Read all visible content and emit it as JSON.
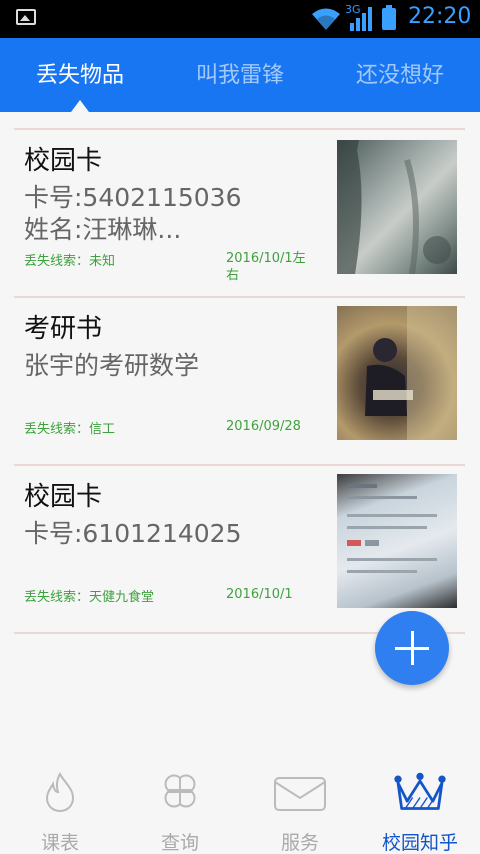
{
  "status": {
    "time": "22:20",
    "network": "3G"
  },
  "tabs": [
    {
      "label": "丢失物品",
      "active": true
    },
    {
      "label": "叫我雷锋",
      "active": false
    },
    {
      "label": "还没想好",
      "active": false
    }
  ],
  "items": [
    {
      "title": "校园卡",
      "desc": "卡号:5402115036\n姓名:汪琳琳...",
      "clue": "丢失线索：未知",
      "date": "2016/10/1左右"
    },
    {
      "title": "考研书",
      "desc": "张宇的考研数学",
      "clue": "丢失线索：信工",
      "date": "2016/09/28"
    },
    {
      "title": "校园卡",
      "desc": "卡号:6101214025",
      "clue": "丢失线索：天健九食堂",
      "date": "2016/10/1"
    }
  ],
  "fab": {
    "icon": "plus-icon"
  },
  "bottom_nav": [
    {
      "label": "课表",
      "icon": "flame-icon",
      "active": false
    },
    {
      "label": "查询",
      "icon": "four-leaf-icon",
      "active": false
    },
    {
      "label": "服务",
      "icon": "envelope-icon",
      "active": false
    },
    {
      "label": "校园知乎",
      "icon": "crown-icon",
      "active": true
    }
  ],
  "colors": {
    "primary": "#1976f2",
    "accent_fab": "#2f7ff0",
    "clue_green": "#3ea13e",
    "active_nav": "#1456c8"
  }
}
